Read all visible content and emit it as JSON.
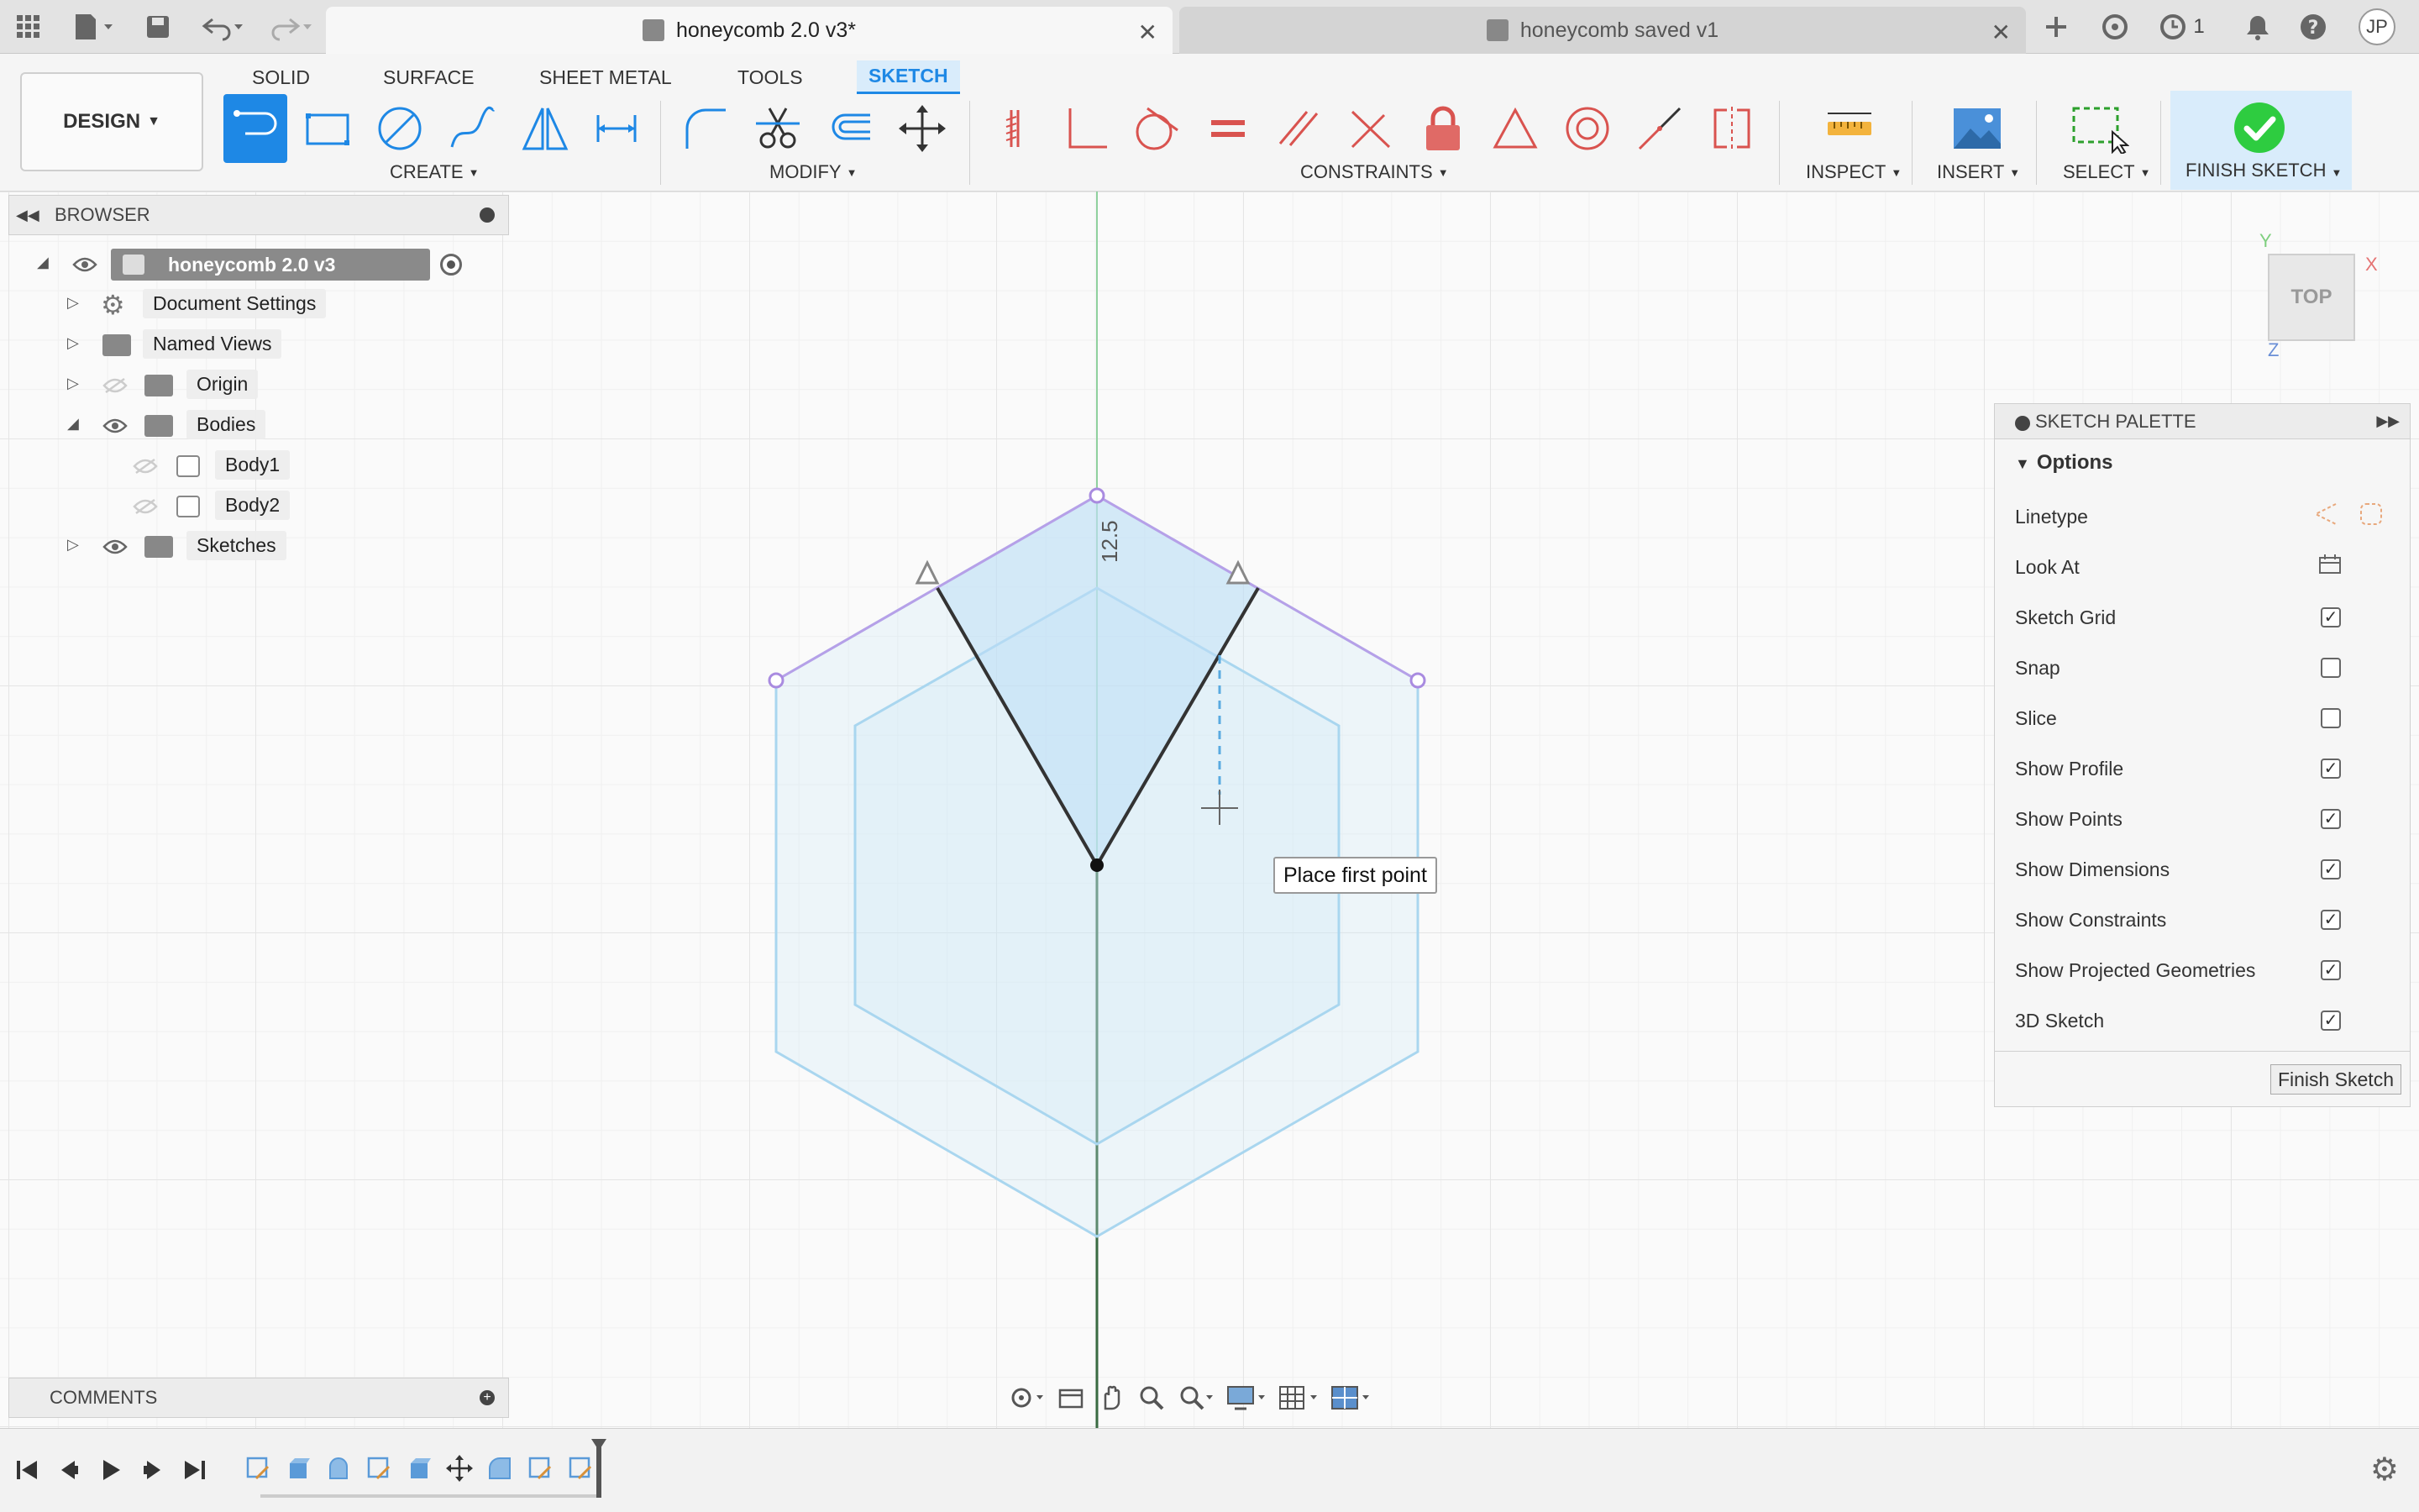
{
  "tabs": [
    {
      "title": "honeycomb 2.0 v3*",
      "active": true
    },
    {
      "title": "honeycomb saved v1",
      "active": false
    }
  ],
  "header": {
    "jobs_count": "1",
    "user_initials": "JP"
  },
  "toolbar": {
    "design_label": "DESIGN",
    "workspace_tabs": [
      "SOLID",
      "SURFACE",
      "SHEET METAL",
      "TOOLS",
      "SKETCH"
    ],
    "groups": {
      "create": "CREATE",
      "modify": "MODIFY",
      "constraints": "CONSTRAINTS",
      "inspect": "INSPECT",
      "insert": "INSERT",
      "select": "SELECT",
      "finish": "FINISH SKETCH"
    }
  },
  "browser": {
    "title": "BROWSER",
    "items": [
      {
        "label": "honeycomb 2.0 v3"
      },
      {
        "label": "Document Settings"
      },
      {
        "label": "Named Views"
      },
      {
        "label": "Origin"
      },
      {
        "label": "Bodies"
      },
      {
        "label": "Body1"
      },
      {
        "label": "Body2"
      },
      {
        "label": "Sketches"
      }
    ]
  },
  "viewcube": {
    "face": "TOP",
    "axis_x": "X",
    "axis_y": "Y",
    "axis_z": "Z"
  },
  "sketch": {
    "dimension_value": "12.5"
  },
  "tooltip": "Place first point",
  "palette": {
    "title": "SKETCH PALETTE",
    "section": "Options",
    "rows": [
      {
        "label": "Linetype",
        "type": "icons"
      },
      {
        "label": "Look At",
        "type": "icon"
      },
      {
        "label": "Sketch Grid",
        "checked": true
      },
      {
        "label": "Snap",
        "checked": false
      },
      {
        "label": "Slice",
        "checked": false
      },
      {
        "label": "Show Profile",
        "checked": true
      },
      {
        "label": "Show Points",
        "checked": true
      },
      {
        "label": "Show Dimensions",
        "checked": true
      },
      {
        "label": "Show Constraints",
        "checked": true
      },
      {
        "label": "Show Projected Geometries",
        "checked": true
      },
      {
        "label": "3D Sketch",
        "checked": true
      }
    ],
    "finish_button": "Finish Sketch"
  },
  "comments": {
    "title": "COMMENTS"
  },
  "colors": {
    "accent": "#1e88e5",
    "constraint_red": "#d9534f",
    "sketch_blue": "#a9d6ef",
    "finish_green": "#2ecc40"
  }
}
